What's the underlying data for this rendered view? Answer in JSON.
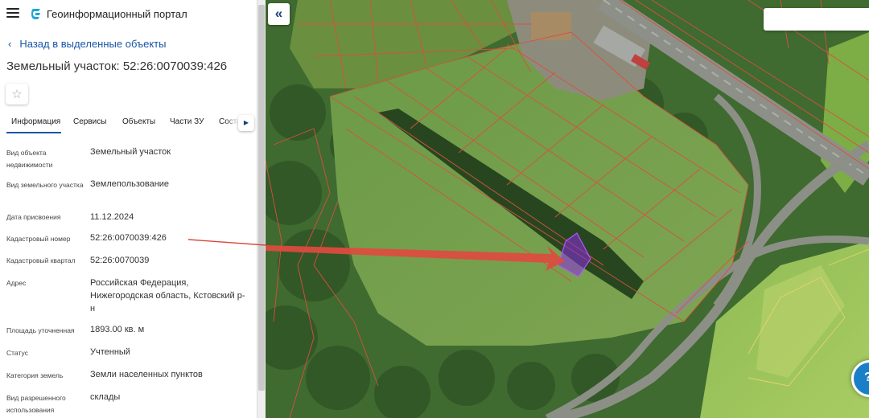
{
  "header": {
    "app_title": "Геоинформационный портал",
    "menu_icon": "hamburger-menu-icon",
    "logo_icon": "portal-logo-icon"
  },
  "navigation": {
    "back_label": "Назад в выделенные объекты"
  },
  "object": {
    "title": "Земельный участок: 52:26:0070039:426",
    "favorite_icon": "star-icon"
  },
  "tabs": [
    {
      "label": "Информация",
      "active": true
    },
    {
      "label": "Сервисы",
      "active": false
    },
    {
      "label": "Объекты",
      "active": false
    },
    {
      "label": "Части ЗУ",
      "active": false
    },
    {
      "label": "Состав",
      "active": false
    }
  ],
  "properties": [
    {
      "label": "Вид объекта недвижимости",
      "value": "Земельный участок"
    },
    {
      "label": "Вид земельного участка",
      "value": "Землепользование"
    },
    {
      "label": "Дата присвоения",
      "value": "11.12.2024"
    },
    {
      "label": "Кадастровый номер",
      "value": "52:26:0070039:426"
    },
    {
      "label": "Кадастровый квартал",
      "value": "52:26:0070039"
    },
    {
      "label": "Адрес",
      "value": "Российская Федерация, Нижегородская область, Кстовский р-н"
    },
    {
      "label": "Площадь уточненная",
      "value": "1893.00 кв. м"
    },
    {
      "label": "Статус",
      "value": "Учтенный"
    },
    {
      "label": "Категория земель",
      "value": "Земли населенных пунктов"
    },
    {
      "label": "Вид разрешенного использования",
      "value": "склады"
    }
  ],
  "map": {
    "collapse_icon": "double-chevron-left-icon",
    "search_value": "",
    "chat_icon": "chat-icon",
    "colors": {
      "parcel_border": "#d9503f",
      "selected_parcel": "#8a2be2",
      "arrow": "#e04a3f",
      "field": "#6f9a45",
      "forest": "#2f5a26",
      "road": "#8c8f86"
    }
  }
}
